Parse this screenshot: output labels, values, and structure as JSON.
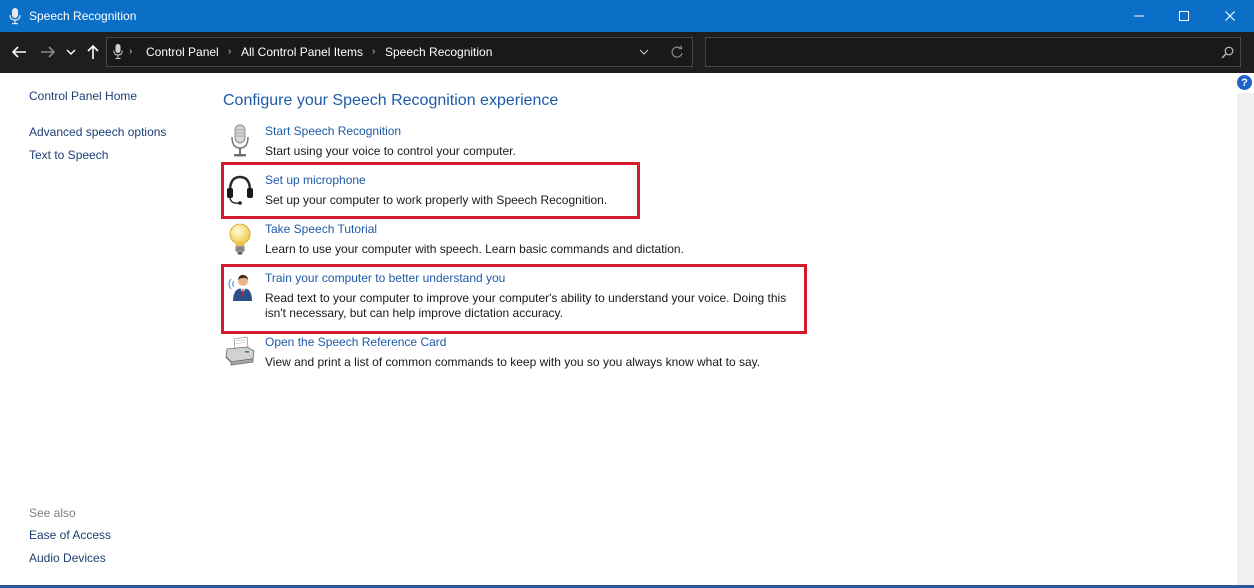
{
  "window": {
    "title": "Speech Recognition"
  },
  "address": {
    "crumbs": [
      "Control Panel",
      "All Control Panel Items",
      "Speech Recognition"
    ],
    "search_placeholder": ""
  },
  "sidebar": {
    "home": "Control Panel Home",
    "items": [
      "Advanced speech options",
      "Text to Speech"
    ],
    "see_also_label": "See also",
    "see_also": [
      "Ease of Access",
      "Audio Devices"
    ]
  },
  "main": {
    "heading": "Configure your Speech Recognition experience",
    "tasks": [
      {
        "link": "Start Speech Recognition",
        "desc": "Start using your voice to control your computer.",
        "icon": "microphone-icon"
      },
      {
        "link": "Set up microphone",
        "desc": "Set up your computer to work properly with Speech Recognition.",
        "icon": "headset-icon",
        "highlighted": true
      },
      {
        "link": "Take Speech Tutorial",
        "desc": "Learn to use your computer with speech.  Learn basic commands and dictation.",
        "icon": "lightbulb-icon"
      },
      {
        "link": "Train your computer to better understand you",
        "desc": "Read text to your computer to improve your computer's ability to understand your voice.  Doing this isn't necessary, but can help improve dictation accuracy.",
        "icon": "user-speaking-icon",
        "highlighted": true
      },
      {
        "link": "Open the Speech Reference Card",
        "desc": "View and print a list of common commands to keep with you so you always know what to say.",
        "icon": "printer-icon"
      }
    ]
  },
  "colors": {
    "titlebar": "#0b6fc8",
    "addressbar": "#1e1e1e",
    "link": "#1e5aa8",
    "highlight": "#d41b2c"
  }
}
